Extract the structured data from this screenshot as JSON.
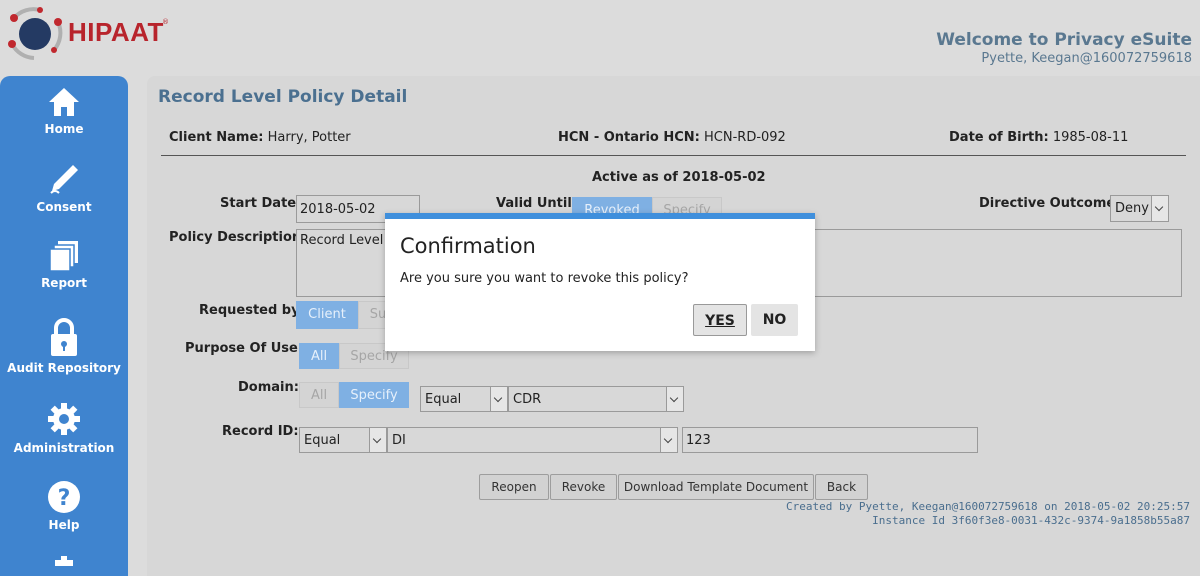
{
  "header": {
    "brand": "HIPAAT",
    "brand_mark": "®",
    "welcome": "Welcome to Privacy eSuite",
    "user": "Pyette, Keegan@160072759618"
  },
  "sidebar": {
    "items": [
      {
        "label": "Home",
        "icon": "home-icon"
      },
      {
        "label": "Consent",
        "icon": "pen-icon"
      },
      {
        "label": "Report",
        "icon": "documents-icon"
      },
      {
        "label": "Audit Repository",
        "icon": "lock-icon"
      },
      {
        "label": "Administration",
        "icon": "gear-icon"
      },
      {
        "label": "Help",
        "icon": "help-icon"
      }
    ]
  },
  "page": {
    "title": "Record Level Policy Detail",
    "client": {
      "label": "Client Name:",
      "value": "Harry, Potter"
    },
    "hcn": {
      "label": "HCN - Ontario HCN:",
      "value": "HCN-RD-092"
    },
    "dob": {
      "label": "Date of Birth:",
      "value": "1985-08-11"
    },
    "active_as_of": "Active as of 2018-05-02",
    "start_date": {
      "label": "Start Date:",
      "value": "2018-05-02"
    },
    "valid_until": {
      "label": "Valid Until:",
      "options": [
        "Revoked",
        "Specify"
      ]
    },
    "directive_outcome": {
      "label": "Directive Outcome:",
      "value": "Deny"
    },
    "policy_description": {
      "label": "Policy Description:",
      "value": "Record Level P"
    },
    "requested_by": {
      "label": "Requested by:",
      "options": [
        "Client",
        "Su"
      ]
    },
    "purpose_of_use": {
      "label": "Purpose Of Use:",
      "options": [
        "All",
        "Specify"
      ]
    },
    "domain": {
      "label": "Domain:",
      "options": [
        "All",
        "Specify"
      ],
      "operator": "Equal",
      "value": "CDR"
    },
    "record_id": {
      "label": "Record ID:",
      "operator": "Equal",
      "type": "DI",
      "value": "123"
    },
    "buttons": [
      "Reopen",
      "Revoke",
      "Download Template Document",
      "Back"
    ],
    "created_by": "Created by Pyette, Keegan@160072759618 on 2018-05-02 20:25:57",
    "instance_id": "Instance Id 3f60f3e8-0031-432c-9374-9a1858b55a87"
  },
  "dialog": {
    "title": "Confirmation",
    "message": "Are you sure you want to revoke this policy?",
    "yes": "YES",
    "no": "NO"
  },
  "colors": {
    "sidebar": "#3f84cf",
    "brand": "#b8242c",
    "accent": "#4b7090",
    "segment_active": "#7fb0e3",
    "dialog_top": "#3f8fdc"
  }
}
